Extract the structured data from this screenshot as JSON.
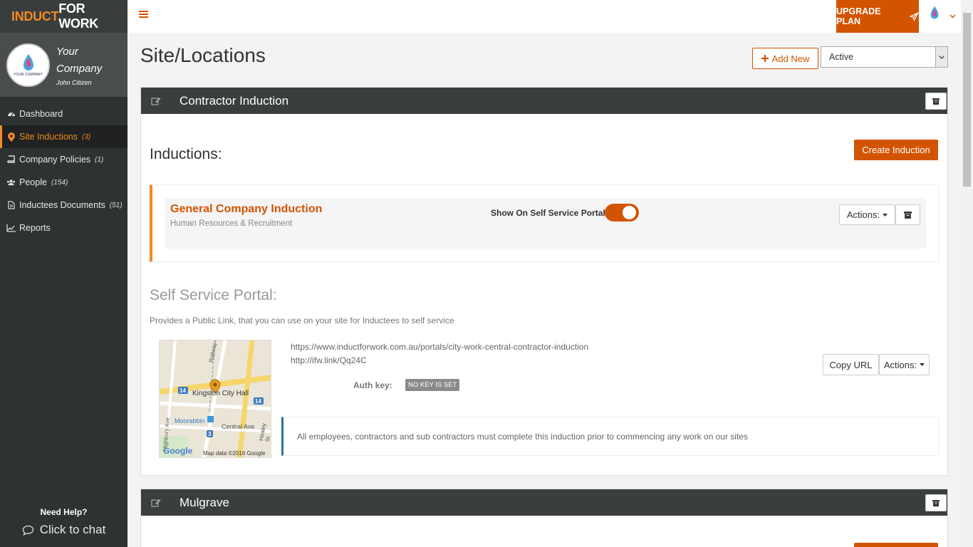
{
  "brand": {
    "part1": "INDUCT",
    "part2": "FOR WORK"
  },
  "company": {
    "name": "Your Company",
    "user": "John Citizen",
    "logo_caption": "YOUR COMPANY"
  },
  "sidebar": {
    "items": [
      {
        "label": "Dashboard",
        "count": "",
        "icon": "dashboard-icon"
      },
      {
        "label": "Site Inductions",
        "count": "(3)",
        "icon": "map-pin-icon"
      },
      {
        "label": "Company Policies",
        "count": "(1)",
        "icon": "book-icon"
      },
      {
        "label": "People",
        "count": "(154)",
        "icon": "users-icon"
      },
      {
        "label": "Inductees Documents",
        "count": "(51)",
        "icon": "document-icon"
      },
      {
        "label": "Reports",
        "count": "",
        "icon": "chart-icon"
      }
    ],
    "help_title": "Need Help?",
    "chat_label": "Click to chat"
  },
  "topbar": {
    "upgrade_label": "UPGRADE PLAN"
  },
  "page": {
    "title": "Site/Locations",
    "add_new_label": "Add New",
    "filter_value": "Active"
  },
  "panels": [
    {
      "title": "Contractor Induction",
      "inductions_heading": "Inductions:",
      "create_label": "Create Induction",
      "induction": {
        "name": "General Company Induction",
        "dept": "Human Resources & Recruitment",
        "ssp_label": "Show On Self Service Portal:",
        "actions_label": "Actions:"
      },
      "ssp": {
        "title": "Self Service Portal:",
        "desc": "Provides a Public Link, that you can use on your site for Inductees to self service",
        "url_long": "https://www.inductforwork.com.au/portals/city-work-central-contractor-induction",
        "url_short": "http://ifw.link/Qq24C",
        "auth_label": "Auth key:",
        "auth_value": "NO KEY IS SET",
        "copy_label": "Copy URL",
        "actions_label": "Actions:",
        "note": "All employees, contractors and sub contractors must complete this induction prior to commencing any work on our sites"
      },
      "map": {
        "place": "Kingston City Hall",
        "station": "Moorabbin",
        "streets": [
          "Railway Cres",
          "Highbury Ave",
          "Central Ave",
          "Healey St"
        ],
        "route": "14",
        "route2": "3",
        "provider": "Google",
        "attribution": "Map data ©2016 Google"
      }
    },
    {
      "title": "Mulgrave"
    }
  ]
}
